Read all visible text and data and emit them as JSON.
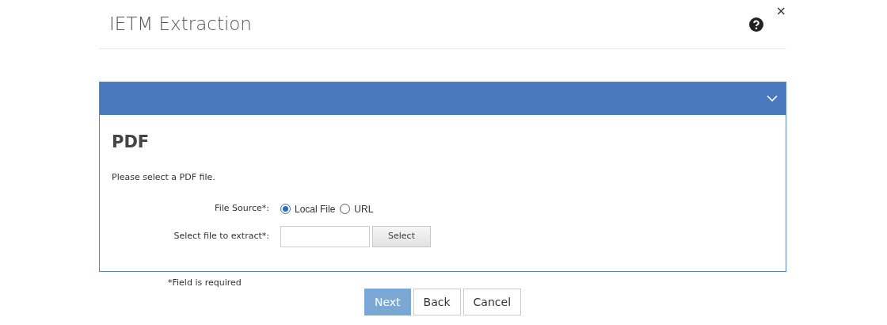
{
  "dialog": {
    "title": "IETM Extraction",
    "close": "×"
  },
  "panel": {
    "expanded": true,
    "heading": "PDF",
    "instructions": "Please select a PDF file.",
    "fields": [
      {
        "kind": "radio",
        "label": "File Source*:",
        "options": [
          {
            "label": "Local File",
            "selected": true
          },
          {
            "label": "URL",
            "selected": false
          }
        ]
      },
      {
        "kind": "file",
        "label": "Select file to extract*:",
        "button": "Select"
      }
    ]
  },
  "required_note": "*Field is required",
  "buttons": [
    {
      "label": "Next",
      "kind": "primary",
      "disabled": true
    },
    {
      "label": "Back",
      "kind": "default",
      "disabled": false
    },
    {
      "label": "Cancel",
      "kind": "default",
      "disabled": false
    }
  ]
}
